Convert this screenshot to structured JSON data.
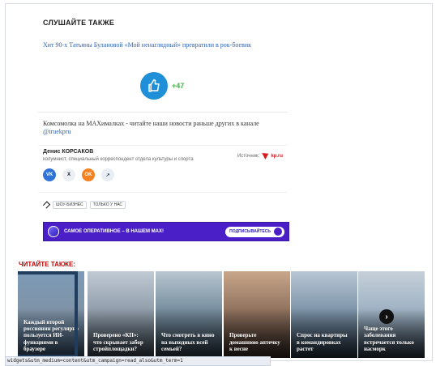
{
  "section": {
    "title": "СЛУШАЙТЕ ТАКЖЕ",
    "link": "Хит 90-х Татьяны Булановой «Мой ненаглядный» превратили в рок-боевик",
    "vote_count": "+47",
    "max_text": "Комсомолка на MAXималках - читайте наши новости раньше других в канале",
    "max_handle": "@truekpru",
    "author_name": "Денис КОРСАКОВ",
    "author_role": "колумнист, специальный корреспондент отдела культуры и спорта",
    "source_label": "Источник:",
    "source_name": "kp.ru",
    "tags": [
      "ШОУ-БИЗНЕС",
      "ТОЛЬКО У НАС"
    ],
    "banner_text": "САМОЕ ОПЕРАТИВНОЕ – В НАШЕМ MAX!",
    "banner_button": "ПОДПИСЫВАЙТЕСЬ"
  },
  "more": {
    "title": "ЧИТАЙТЕ ТАКЖЕ:",
    "cards": [
      {
        "title": "Каждый второй россиянин регулярно пользуется ИИ-функциями в браузере"
      },
      {
        "title": "Проверено «КП»: что скрывает забор стройплощадки?"
      },
      {
        "title": "Что смотреть в кино на выходных всей семьей?"
      },
      {
        "title": "Проверьте домашнюю аптечку к весне"
      },
      {
        "title": "Спрос на квартиры в командировках растет"
      },
      {
        "title": "Чаще этого заболевания встречается только насморк"
      }
    ]
  },
  "url_bar": "widgets&utm_medium=content&utm_campaign=read_also&utm_term=1",
  "colors": {
    "accent_blue": "#2f66b6",
    "vote_green": "#4caf50",
    "banner_purple": "#4a1fc7",
    "read_also_red": "#c80000"
  },
  "icons": {
    "vote": "thumbs-up-icon",
    "share": [
      "vk-icon",
      "x-icon",
      "ok-icon",
      "link-icon"
    ],
    "tag": "tag-icon",
    "next": "chevron-right-icon"
  }
}
